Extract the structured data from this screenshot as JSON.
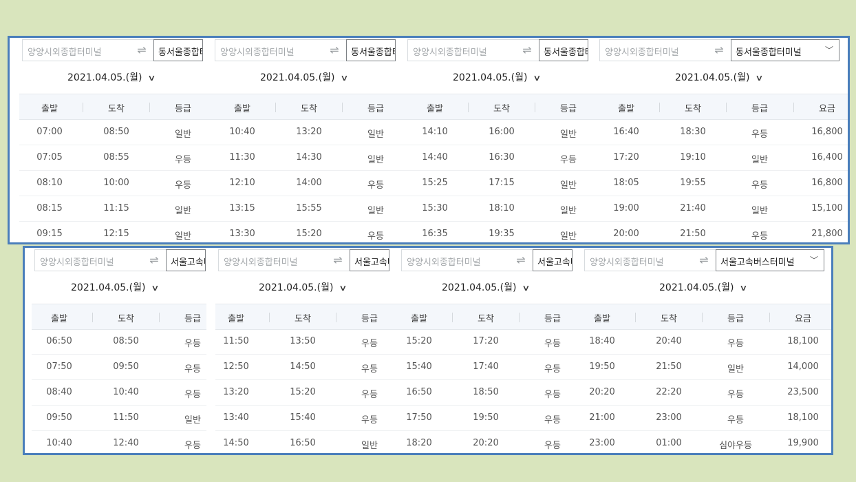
{
  "top": {
    "from_placeholder": "양양시외종합터미널",
    "swap_icon": "⇌",
    "date": "2021.04.05.(월)",
    "to_label": "동서울종합터미널",
    "headers": {
      "depart": "출발",
      "arrive": "도착",
      "grade": "등급",
      "fare": "요금"
    },
    "columns": [
      {
        "rows": [
          [
            "07:00",
            "08:50",
            "일반"
          ],
          [
            "07:05",
            "08:55",
            "우등"
          ],
          [
            "08:10",
            "10:00",
            "우등"
          ],
          [
            "08:15",
            "11:15",
            "일반"
          ],
          [
            "09:15",
            "12:15",
            "일반"
          ]
        ]
      },
      {
        "rows": [
          [
            "10:40",
            "13:20",
            "일반"
          ],
          [
            "11:30",
            "14:30",
            "일반"
          ],
          [
            "12:10",
            "14:00",
            "우등"
          ],
          [
            "13:15",
            "15:55",
            "일반"
          ],
          [
            "13:30",
            "15:20",
            "우등"
          ]
        ]
      },
      {
        "rows": [
          [
            "14:10",
            "16:00",
            "일반"
          ],
          [
            "14:40",
            "16:30",
            "우등"
          ],
          [
            "15:25",
            "17:15",
            "일반"
          ],
          [
            "15:30",
            "18:10",
            "일반"
          ],
          [
            "16:35",
            "19:35",
            "일반"
          ]
        ]
      },
      {
        "rows": [
          [
            "16:40",
            "18:30",
            "우등",
            "16,800"
          ],
          [
            "17:20",
            "19:10",
            "일반",
            "16,400"
          ],
          [
            "18:05",
            "19:55",
            "우등",
            "16,800"
          ],
          [
            "19:00",
            "21:40",
            "일반",
            "15,100"
          ],
          [
            "20:00",
            "21:50",
            "우등",
            "21,800"
          ]
        ]
      }
    ]
  },
  "bottom": {
    "from_placeholder": "양양시외종합터미널",
    "swap_icon": "⇌",
    "date": "2021.04.05.(월)",
    "to_label": "서울고속버스터미널",
    "headers": {
      "depart": "출발",
      "arrive": "도착",
      "grade": "등급",
      "fare": "요금"
    },
    "columns": [
      {
        "rows": [
          [
            "06:50",
            "08:50",
            "우등"
          ],
          [
            "07:50",
            "09:50",
            "우등"
          ],
          [
            "08:40",
            "10:40",
            "우등"
          ],
          [
            "09:50",
            "11:50",
            "일반"
          ],
          [
            "10:40",
            "12:40",
            "우등"
          ]
        ]
      },
      {
        "rows": [
          [
            "11:50",
            "13:50",
            "우등"
          ],
          [
            "12:50",
            "14:50",
            "우등"
          ],
          [
            "13:20",
            "15:20",
            "우등"
          ],
          [
            "13:40",
            "15:40",
            "우등"
          ],
          [
            "14:50",
            "16:50",
            "일반"
          ]
        ]
      },
      {
        "rows": [
          [
            "15:20",
            "17:20",
            "우등"
          ],
          [
            "15:40",
            "17:40",
            "우등"
          ],
          [
            "16:50",
            "18:50",
            "우등"
          ],
          [
            "17:50",
            "19:50",
            "우등"
          ],
          [
            "18:20",
            "20:20",
            "우등"
          ]
        ]
      },
      {
        "rows": [
          [
            "18:40",
            "20:40",
            "우등",
            "18,100"
          ],
          [
            "19:50",
            "21:50",
            "일반",
            "14,000"
          ],
          [
            "20:20",
            "22:20",
            "우등",
            "23,500"
          ],
          [
            "21:00",
            "23:00",
            "우등",
            "18,100"
          ],
          [
            "23:00",
            "01:00",
            "심야우등",
            "19,900"
          ]
        ]
      }
    ]
  }
}
